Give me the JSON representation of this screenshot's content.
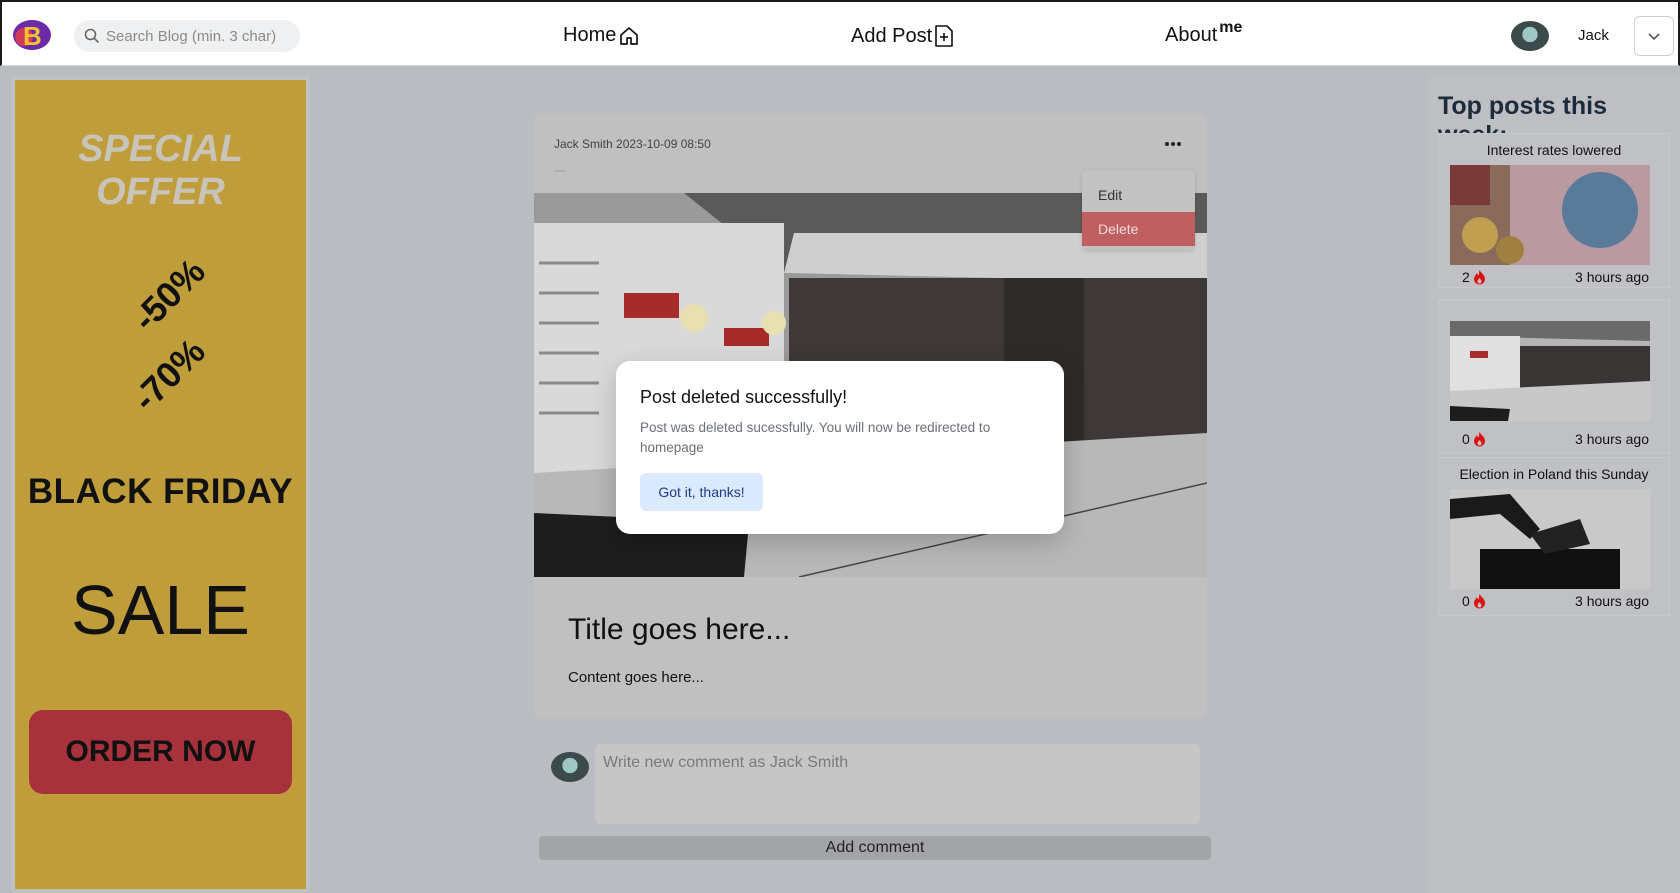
{
  "nav": {
    "logo_letter": "B",
    "search_placeholder": "Search Blog (min. 3 char)",
    "home_label": "Home",
    "add_post_label": "Add Post",
    "about_label": "About",
    "about_sup": "me",
    "user_name": "Jack"
  },
  "ad": {
    "special_offer": "SPECIAL OFFER",
    "discount1": "-50%",
    "discount2": "-70%",
    "black_friday": "BLACK FRIDAY",
    "sale": "SALE",
    "order_button": "ORDER NOW",
    "background_color": "#c09d3b",
    "button_color": "#a8323b"
  },
  "post": {
    "meta": "Jack Smith 2023-10-09 08:50",
    "menu_icon": "more-horizontal-icon",
    "title": "Title goes here...",
    "content": "Content goes here...",
    "menu": {
      "edit_label": "Edit",
      "delete_label": "Delete"
    }
  },
  "comment": {
    "placeholder": "Write new comment as Jack Smith",
    "add_button": "Add comment"
  },
  "sidebar": {
    "title": "Top posts this week:",
    "posts": [
      {
        "title": "Interest rates lowered",
        "likes": "2",
        "time": "3 hours ago"
      },
      {
        "title": "",
        "likes": "0",
        "time": "3 hours ago"
      },
      {
        "title": "Election in Poland this Sunday",
        "likes": "0",
        "time": "3 hours ago"
      }
    ]
  },
  "modal": {
    "title": "Post deleted successfully!",
    "text": "Post was deleted sucessfully. You will now be redirected to homepage",
    "button": "Got it, thanks!"
  }
}
